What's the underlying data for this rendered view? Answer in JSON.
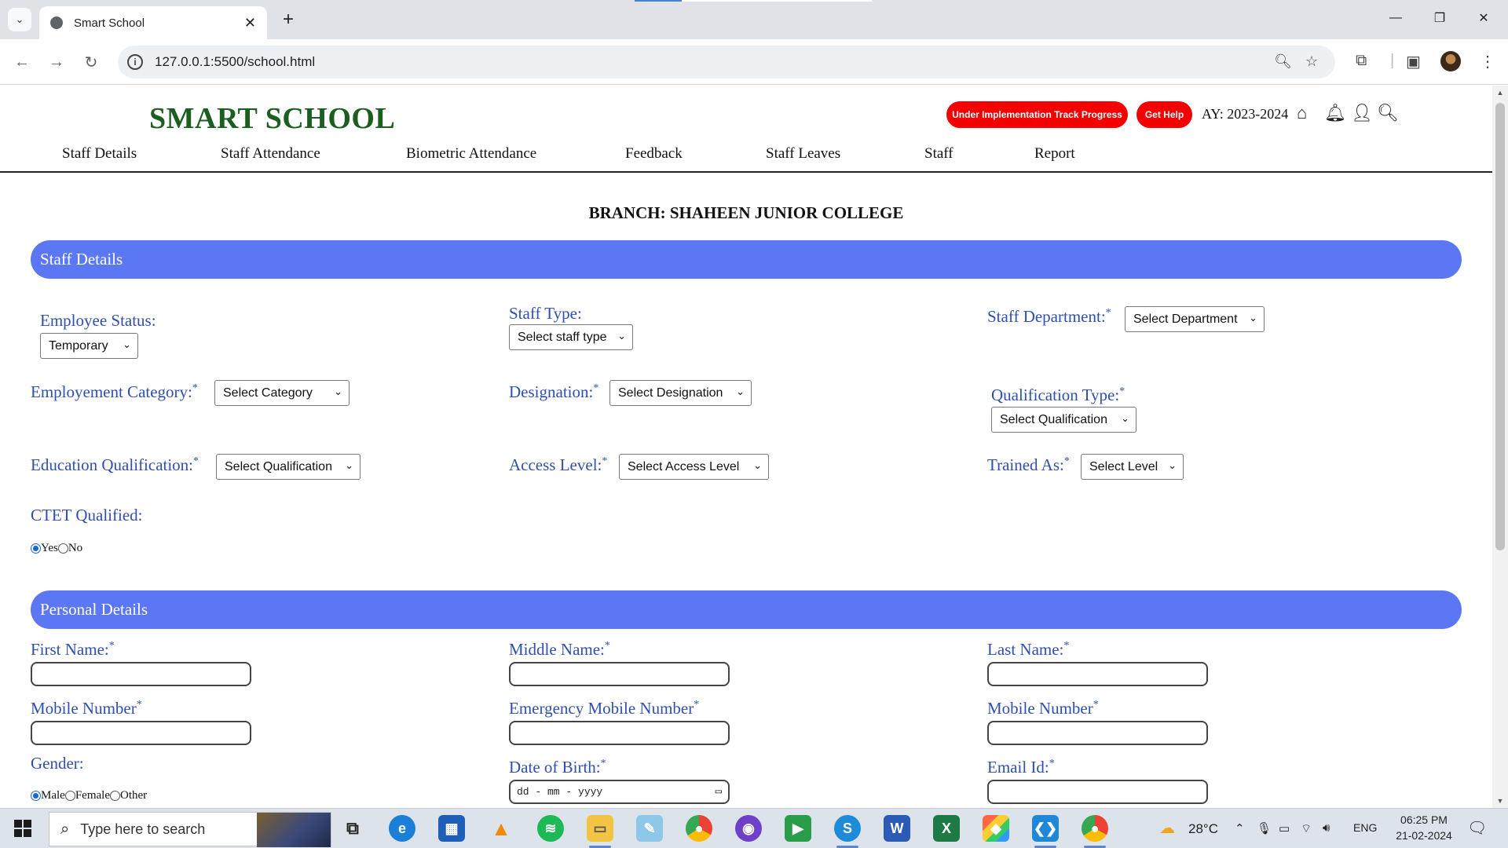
{
  "browser": {
    "tab_title": "Smart School",
    "url": "127.0.0.1:5500/school.html"
  },
  "header": {
    "brand": "SMART SCHOOL",
    "track_button": "Under Implementation Track Progress",
    "help_button": "Get Help",
    "academic_year": "AY: 2023-2024"
  },
  "nav": {
    "items": [
      "Staff Details",
      "Staff Attendance",
      "Biometric Attendance",
      "Feedback",
      "Staff Leaves",
      "Staff",
      "Report"
    ]
  },
  "branch": "BRANCH: SHAHEEN JUNIOR COLLEGE",
  "staff_section": {
    "title": "Staff Details",
    "employee_status": {
      "label": "Employee Status:",
      "value": "Temporary"
    },
    "staff_type": {
      "label": "Staff Type:",
      "value": "Select staff type"
    },
    "staff_department": {
      "label": "Staff Department:",
      "value": "Select Department"
    },
    "employment_category": {
      "label": "Employement Category:",
      "value": "Select Category"
    },
    "designation": {
      "label": "Designation:",
      "value": "Select Designation"
    },
    "qualification_type": {
      "label": "Qualification Type:",
      "value": "Select Qualification"
    },
    "education_qualification": {
      "label": "Education Qualification:",
      "value": "Select Qualification"
    },
    "access_level": {
      "label": "Access Level:",
      "value": "Select Access Level"
    },
    "trained_as": {
      "label": "Trained As:",
      "value": "Select Level"
    },
    "ctet": {
      "label": "CTET Qualified:",
      "yes": "Yes",
      "no": "No",
      "selected": "Yes"
    }
  },
  "personal_section": {
    "title": "Personal Details",
    "first_name": {
      "label": "First Name:",
      "value": ""
    },
    "middle_name": {
      "label": "Middle Name:",
      "value": ""
    },
    "last_name": {
      "label": "Last Name:",
      "value": ""
    },
    "mobile_number": {
      "label": "Mobile Number",
      "value": ""
    },
    "emergency_mobile": {
      "label": "Emergency Mobile Number",
      "value": ""
    },
    "mobile_number_2": {
      "label": "Mobile Number",
      "value": ""
    },
    "gender": {
      "label": "Gender:",
      "male": "Male",
      "female": "Female",
      "other": "Other",
      "selected": "Male"
    },
    "dob": {
      "label": "Date of Birth:",
      "placeholder": "dd - mm - yyyy"
    },
    "email": {
      "label": "Email Id:",
      "value": ""
    }
  },
  "required_mark": "*",
  "taskbar": {
    "search_placeholder": "Type here to search",
    "weather": "28°C",
    "language": "ENG",
    "time": "06:25 PM",
    "date": "21-02-2024"
  },
  "colors": {
    "brand": "#1b5e20",
    "section_bar": "#5b77f3",
    "label": "#2f4fb0",
    "pill": "#f40000"
  }
}
